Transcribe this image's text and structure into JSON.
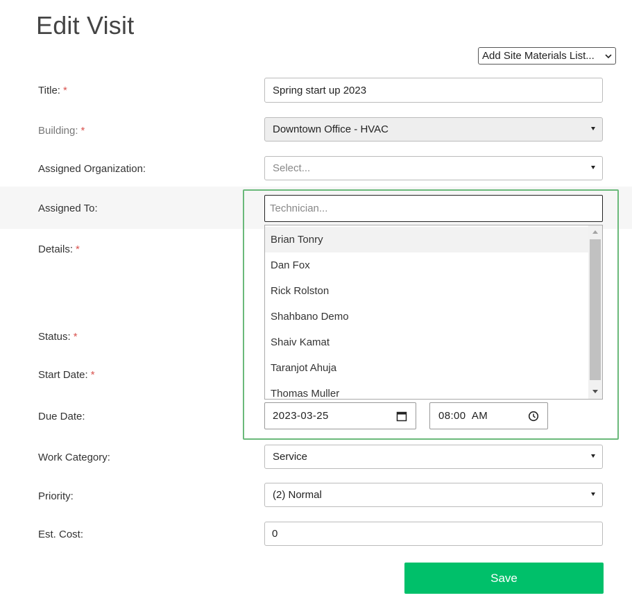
{
  "page": {
    "title": "Edit Visit"
  },
  "materials": {
    "label": "Add Site Materials List..."
  },
  "form": {
    "title": {
      "label": "Title:",
      "required": "*",
      "value": "Spring start up 2023"
    },
    "building": {
      "label": "Building:",
      "required": "*",
      "value": "Downtown Office - HVAC"
    },
    "assigned_organization": {
      "label": "Assigned Organization:",
      "placeholder": "Select..."
    },
    "assigned_to": {
      "label": "Assigned To:",
      "placeholder": "Technician...",
      "options": [
        "Brian Tonry",
        "Dan Fox",
        "Rick Rolston",
        "Shahbano Demo",
        "Shaiv Kamat",
        "Taranjot Ahuja",
        "Thomas Muller"
      ]
    },
    "details": {
      "label": "Details:",
      "required": "*"
    },
    "status": {
      "label": "Status:",
      "required": "*"
    },
    "start_date": {
      "label": "Start Date:",
      "required": "*"
    },
    "due_date": {
      "label": "Due Date:",
      "date": "2023-03-25",
      "time": "08:00  AM"
    },
    "work_category": {
      "label": "Work Category:",
      "value": "Service"
    },
    "priority": {
      "label": "Priority:",
      "value": "(2) Normal"
    },
    "est_cost": {
      "label": "Est. Cost:",
      "value": "0"
    },
    "save_label": "Save"
  },
  "colors": {
    "accent": "#00c06a",
    "focus_frame": "#6ab97a",
    "required": "#d9534f"
  },
  "icons": {
    "calendar": "calendar-icon",
    "clock": "clock-icon",
    "dropdown": "chevron-down-icon"
  }
}
